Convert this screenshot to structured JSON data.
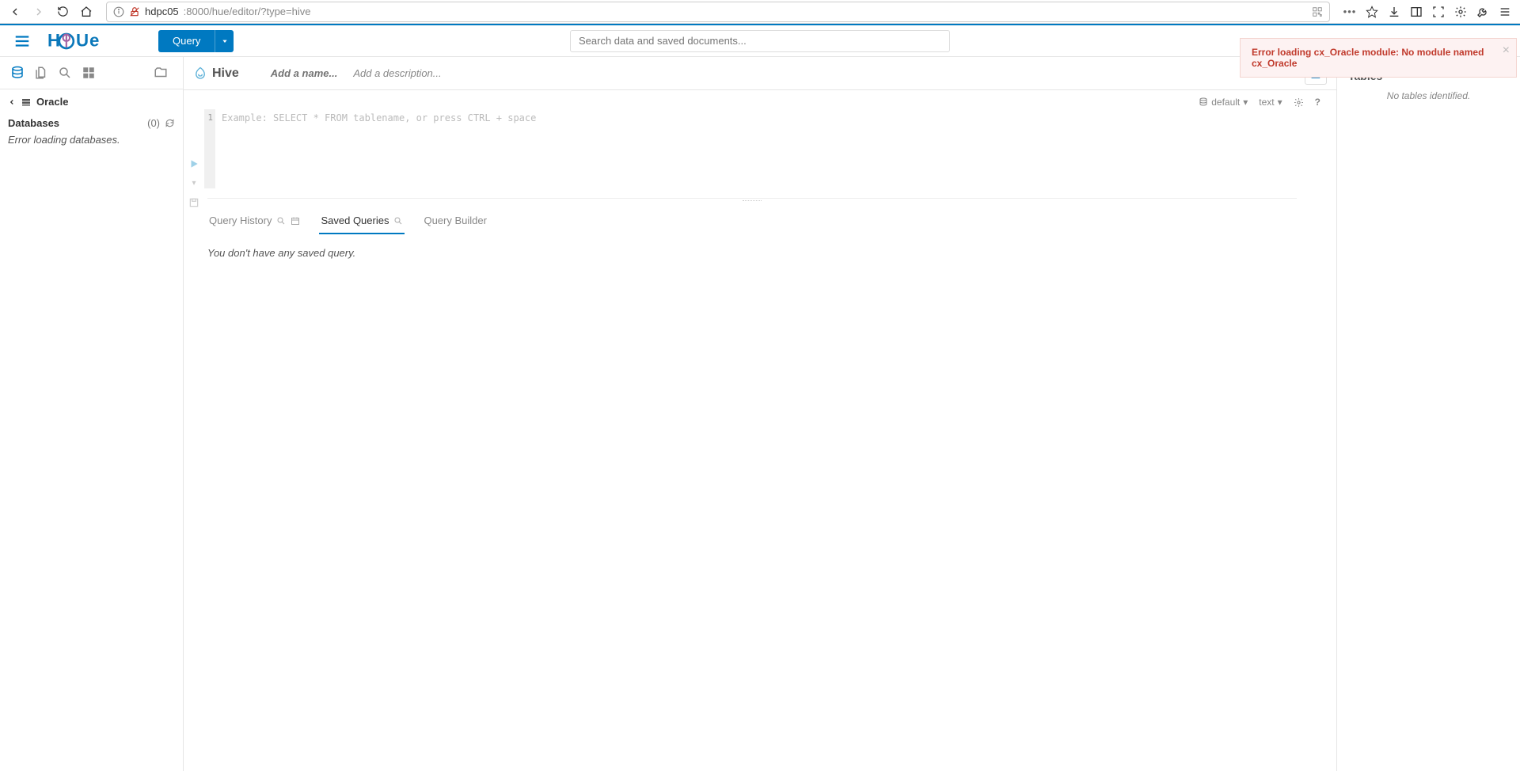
{
  "browser": {
    "url_host": "hdpc05",
    "url_port_path": ":8000/hue/editor/?type=hive"
  },
  "topbar": {
    "query_label": "Query",
    "search_placeholder": "Search data and saved documents..."
  },
  "error": {
    "message": "Error loading cx_Oracle module: No module named cx_Oracle"
  },
  "left": {
    "breadcrumb": "Oracle",
    "databases_label": "Databases",
    "db_count": "(0)",
    "error_msg": "Error loading databases."
  },
  "editor": {
    "engine": "Hive",
    "name_placeholder": "Add a name...",
    "desc_placeholder": "Add a description...",
    "db_selector": "default",
    "mode_selector": "text",
    "line_number": "1",
    "code_placeholder": "Example: SELECT * FROM tablename, or press CTRL + space"
  },
  "tabs": {
    "history": "Query History",
    "saved": "Saved Queries",
    "builder": "Query Builder"
  },
  "results": {
    "empty": "You don't have any saved query."
  },
  "right": {
    "title": "Tables",
    "empty": "No tables identified."
  }
}
